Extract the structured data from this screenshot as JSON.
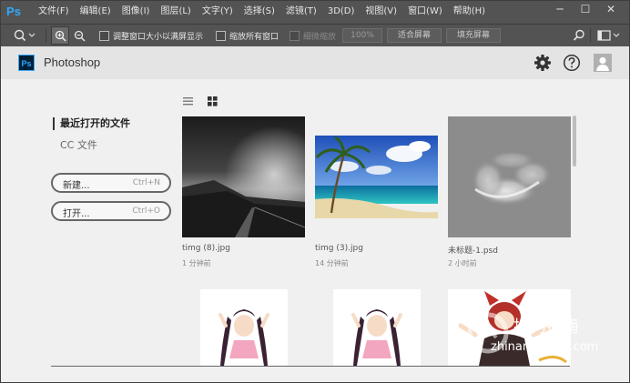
{
  "app": {
    "logo": "Ps",
    "name": "Photoshop"
  },
  "menu": [
    "文件(F)",
    "编辑(E)",
    "图像(I)",
    "图层(L)",
    "文字(Y)",
    "选择(S)",
    "滤镜(T)",
    "3D(D)",
    "视图(V)",
    "窗口(W)",
    "帮助(H)"
  ],
  "window_controls": {
    "minimize": "─",
    "maximize": "☐",
    "close": "✕"
  },
  "options": {
    "resize_windows": "调整窗口大小以满屏显示",
    "zoom_all": "缩放所有窗口",
    "scrubby_zoom": "细微缩放",
    "zoom_percent": "100%",
    "fit_screen": "适合屏幕",
    "fill_screen": "填充屏幕"
  },
  "sidebar": {
    "recent": "最近打开的文件",
    "cc_files": "CC 文件"
  },
  "actions": {
    "new_label": "新建...",
    "new_shortcut": "Ctrl+N",
    "open_label": "打开...",
    "open_shortcut": "Ctrl+O"
  },
  "files": [
    {
      "name": "timg (8).jpg",
      "time": "1 分钟前"
    },
    {
      "name": "timg (3).jpg",
      "time": "14 分钟前"
    },
    {
      "name": "未标题-1.psd",
      "time": "2 小时前"
    }
  ],
  "watermark": {
    "line1": "搜狗指南",
    "line2": "zhinan.sogou.com"
  },
  "colors": {
    "menubar": "#535353",
    "ps_blue": "#31a8ff",
    "ps_dark": "#001e36",
    "panel": "#f0f0f0"
  }
}
